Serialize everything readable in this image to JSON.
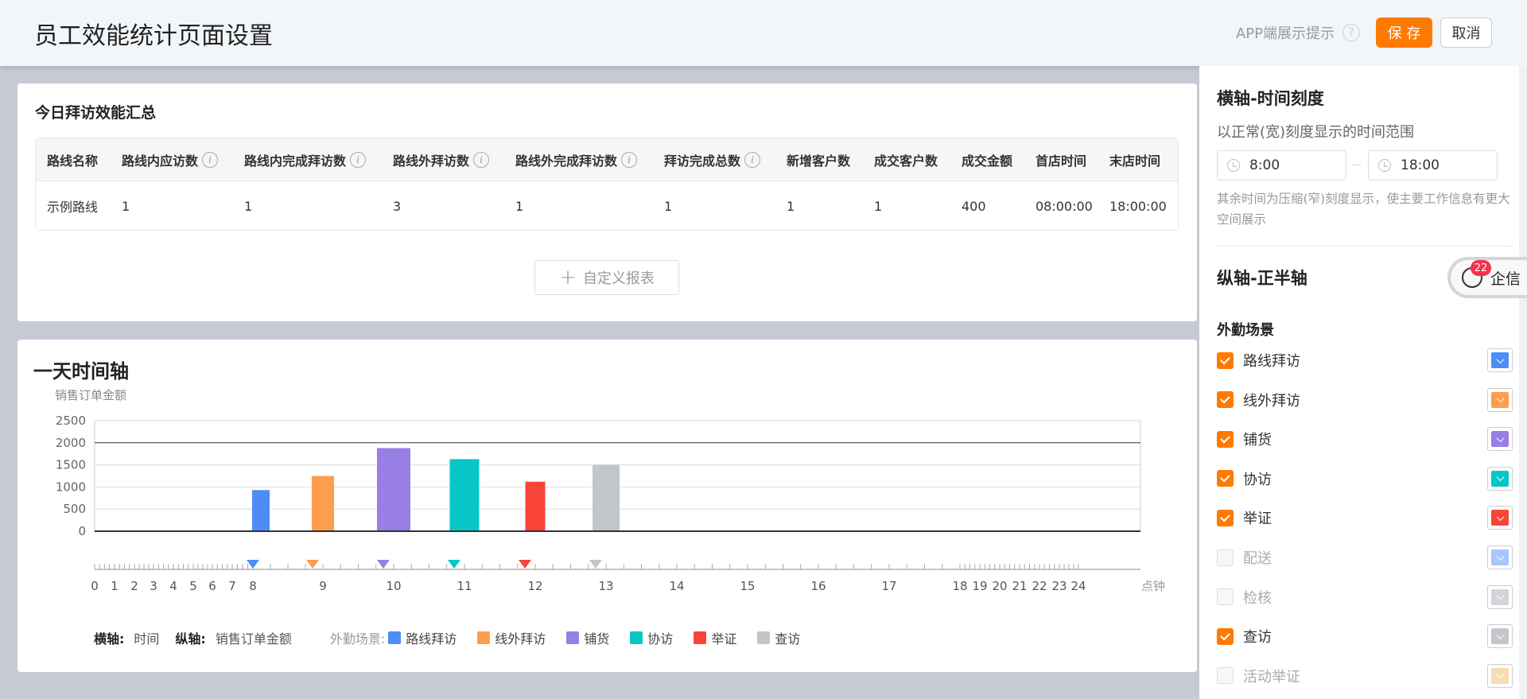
{
  "header": {
    "title": "员工效能统计页面设置",
    "app_tip": "APP端展示提示",
    "help_glyph": "?",
    "save_label": "保 存",
    "cancel_label": "取消"
  },
  "summary": {
    "title": "今日拜访效能汇总",
    "info_glyph": "i",
    "columns": [
      "路线名称",
      "路线内应访数",
      "路线内完成拜访数",
      "路线外拜访数",
      "路线外完成拜访数",
      "拜访完成总数",
      "新增客户数",
      "成交客户数",
      "成交金额",
      "首店时间",
      "末店时间"
    ],
    "rows": [
      [
        "示例路线",
        "1",
        "1",
        "3",
        "1",
        "1",
        "1",
        "1",
        "400",
        "08:00:00",
        "18:00:00"
      ]
    ],
    "custom_report_label": "自定义报表"
  },
  "timeline": {
    "title": "一天时间轴",
    "legend": {
      "x_key": "横轴:",
      "x_value": "时间",
      "y_key": "纵轴:",
      "y_value": "销售订单金额",
      "scene_label": "外勤场景:"
    }
  },
  "chart_data": {
    "type": "bar",
    "ylabel": "销售订单金额",
    "xlabel": "点钟",
    "ylim": [
      0,
      2500
    ],
    "yticks": [
      0,
      500,
      1000,
      1500,
      2000,
      2500
    ],
    "xticks": [
      0,
      1,
      2,
      3,
      4,
      5,
      6,
      7,
      8,
      9,
      10,
      11,
      12,
      13,
      14,
      15,
      16,
      17,
      18,
      19,
      20,
      21,
      22,
      23,
      24
    ],
    "reference_line": 2000,
    "series": [
      {
        "name": "路线拜访",
        "color": "#4e8cf7",
        "x": 8,
        "value": 930
      },
      {
        "name": "线外拜访",
        "color": "#fd9d4d",
        "x": 9,
        "value": 1250
      },
      {
        "name": "铺货",
        "color": "#977fe5",
        "x": 10,
        "value": 1880
      },
      {
        "name": "协访",
        "color": "#06c7c5",
        "x": 11,
        "value": 1630
      },
      {
        "name": "举证",
        "color": "#f9443a",
        "x": 12,
        "value": 1120
      },
      {
        "name": "查访",
        "color": "#c2c5ca",
        "x": 13,
        "value": 1500
      }
    ]
  },
  "panel": {
    "x_axis_title": "横轴-时间刻度",
    "x_axis_sub": "以正常(宽)刻度显示的时间范围",
    "start_time": "8:00",
    "end_time": "18:00",
    "note": "其余时间为压缩(窄)刻度显示，使主要工作信息有更大空间展示",
    "y_axis_title": "纵轴-正半轴",
    "scene_title": "外勤场景",
    "qixin_label": "企信",
    "qixin_badge": "22",
    "scenes": [
      {
        "label": "路线拜访",
        "checked": true,
        "color": "#4e8cf7"
      },
      {
        "label": "线外拜访",
        "checked": true,
        "color": "#fd9d4d"
      },
      {
        "label": "铺货",
        "checked": true,
        "color": "#977fe5"
      },
      {
        "label": "协访",
        "checked": true,
        "color": "#06c7c5"
      },
      {
        "label": "举证",
        "checked": true,
        "color": "#f9443a"
      },
      {
        "label": "配送",
        "checked": false,
        "color": "#a7c6fb"
      },
      {
        "label": "检核",
        "checked": false,
        "color": "#d2d4d9"
      },
      {
        "label": "查访",
        "checked": true,
        "color": "#c2c5ca"
      },
      {
        "label": "活动举证",
        "checked": false,
        "color": "#f6dcb3"
      }
    ]
  }
}
